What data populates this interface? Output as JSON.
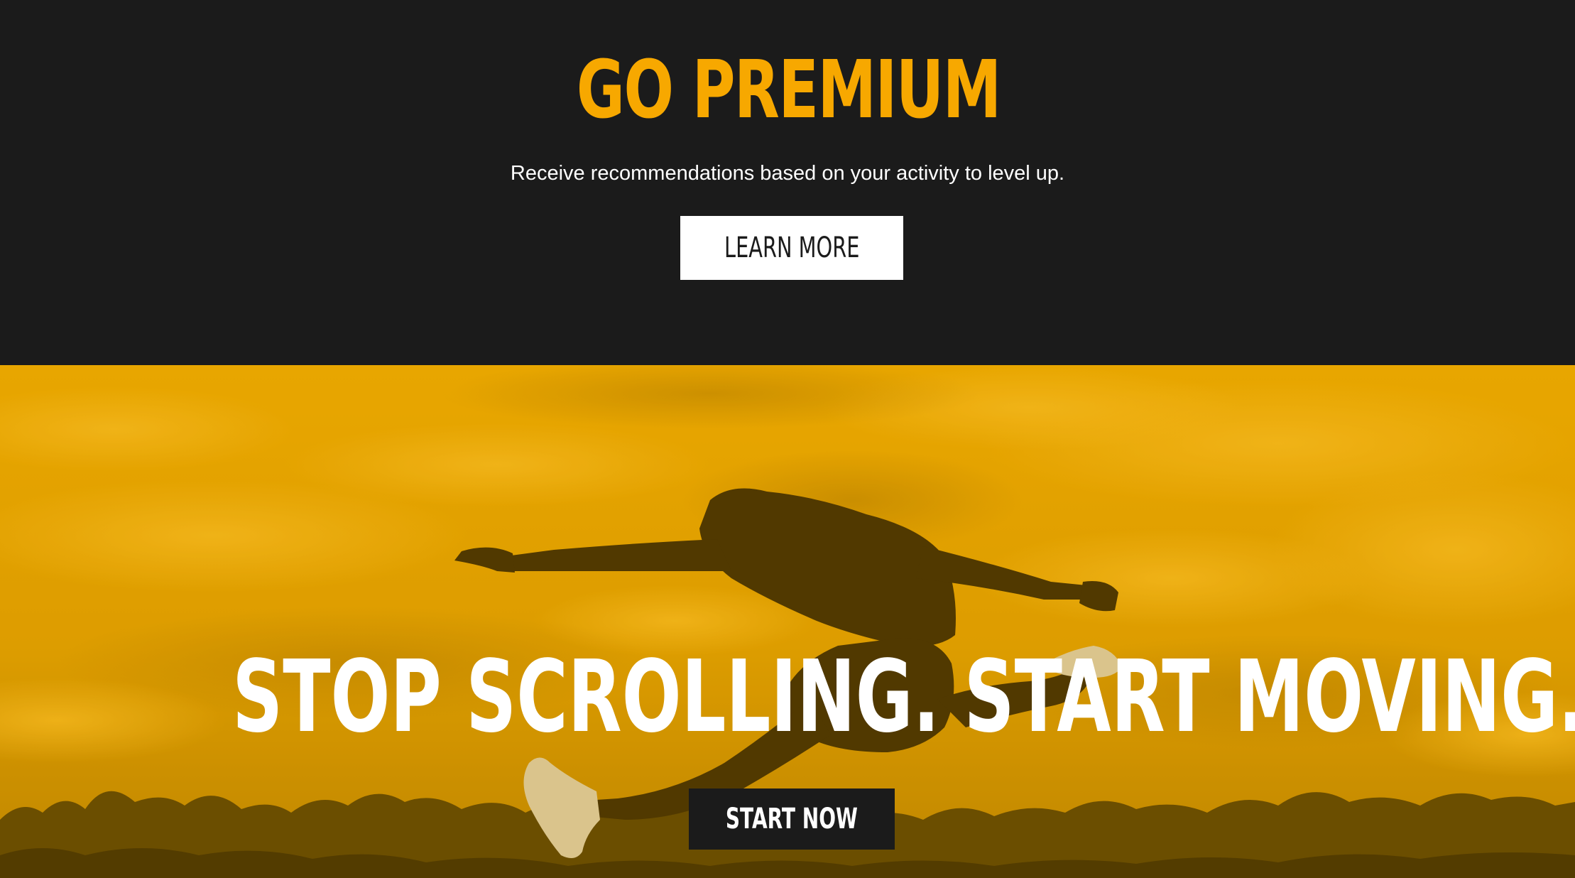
{
  "colors": {
    "background_dark": "#1b1b1b",
    "accent_gold": "#f7a800",
    "hero_tint": "#e2a000",
    "text_light": "#ffffff"
  },
  "premium": {
    "title": "GO PREMIUM",
    "subtitle": "Receive recommendations based on your activity to level up.",
    "button_label": "LEARN MORE"
  },
  "hero": {
    "headline": "STOP SCROLLING. START MOVING.",
    "button_label": "START NOW",
    "image_subject": "person-jumping-photo"
  }
}
